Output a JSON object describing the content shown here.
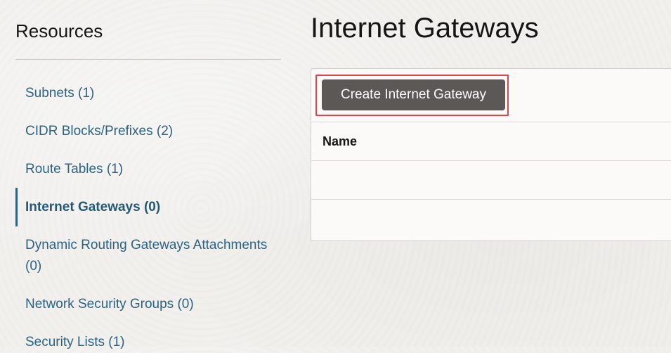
{
  "sidebar": {
    "title": "Resources",
    "items": [
      {
        "label": "Subnets (1)"
      },
      {
        "label": "CIDR Blocks/Prefixes (2)"
      },
      {
        "label": "Route Tables (1)"
      },
      {
        "label": "Internet Gateways (0)",
        "active": true
      },
      {
        "label": "Dynamic Routing Gateways Attachments (0)"
      },
      {
        "label": "Network Security Groups (0)"
      },
      {
        "label": "Security Lists (1)"
      }
    ]
  },
  "main": {
    "title": "Internet Gateways",
    "create_button_label": "Create Internet Gateway",
    "table": {
      "columns": [
        "Name"
      ],
      "rows": [
        [
          ""
        ],
        [
          ""
        ]
      ]
    }
  },
  "colors": {
    "link": "#2c6382",
    "active_indicator": "#2c6382",
    "button_bg": "#5c5856",
    "highlight_border": "#e2444f"
  }
}
